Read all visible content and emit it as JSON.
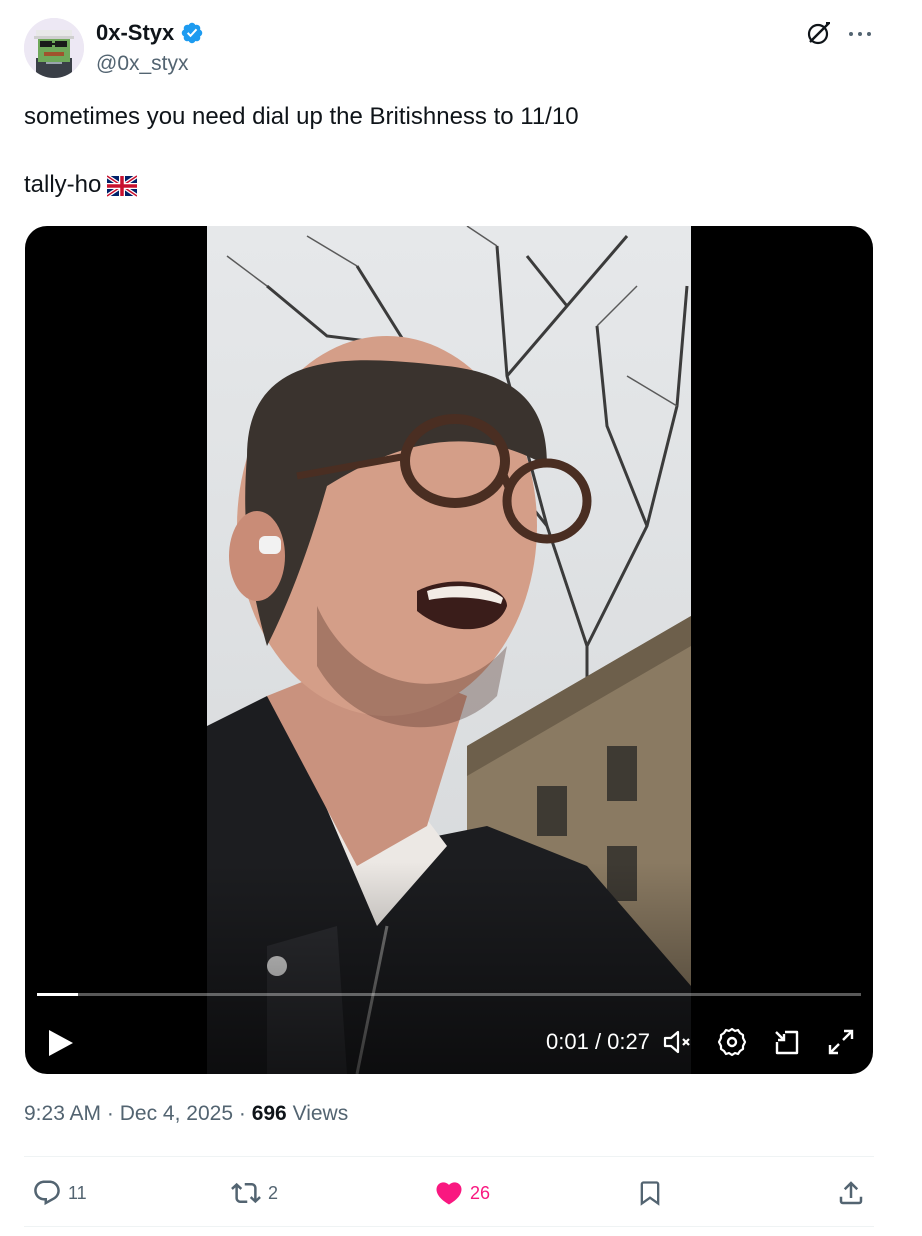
{
  "author": {
    "display_name": "0x-Styx",
    "handle": "@0x_styx",
    "verified": true,
    "avatar_icon": "pepe-frog-avatar-icon"
  },
  "header_icons": {
    "grok": "grok-icon",
    "more": "more-icon"
  },
  "tweet": {
    "lines": [
      "sometimes you need dial up the Britishness to 11/10",
      "",
      "tally-ho"
    ],
    "emoji": "uk-flag-icon"
  },
  "video": {
    "current_time": "0:01",
    "duration": "0:27",
    "time_label": "0:01 / 0:27",
    "progress_fraction": 0.05,
    "controls": [
      "play-icon",
      "muted-speaker-icon",
      "settings-gear-icon",
      "picture-in-picture-icon",
      "fullscreen-icon"
    ]
  },
  "meta": {
    "time": "9:23 AM",
    "sep1": "·",
    "date": "Dec 4, 2025",
    "sep2": "·",
    "views_count": "696",
    "views_label": "Views"
  },
  "actions": {
    "replies": "11",
    "reposts": "2",
    "likes": "26",
    "liked": true
  },
  "colors": {
    "text": "#0f1419",
    "muted": "#536471",
    "verified": "#1d9bf0",
    "like": "#f91880"
  }
}
